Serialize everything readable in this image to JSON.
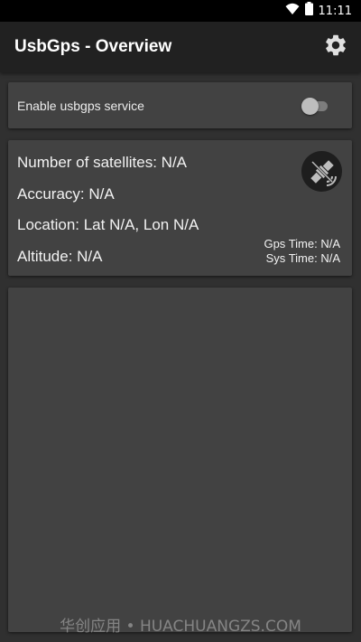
{
  "status_bar": {
    "time": "11:11",
    "icons": [
      "wifi-icon",
      "battery-icon"
    ]
  },
  "app_bar": {
    "title": "UsbGps - Overview",
    "settings_icon": "gear-icon"
  },
  "service": {
    "label": "Enable usbgps service",
    "enabled": false
  },
  "gps_info": {
    "satellites": "Number of satellites: N/A",
    "accuracy": "Accuracy: N/A",
    "location": "Location: Lat N/A, Lon N/A",
    "altitude": "Altitude: N/A",
    "gps_time": "Gps Time: N/A",
    "sys_time": "Sys Time: N/A",
    "status_icon": "satellite-off-icon"
  },
  "watermark": "华创应用 • HUACHUANGZS.COM",
  "colors": {
    "background": "#303030",
    "app_bar": "#212121",
    "card": "#424242",
    "status_bar": "#000000"
  }
}
